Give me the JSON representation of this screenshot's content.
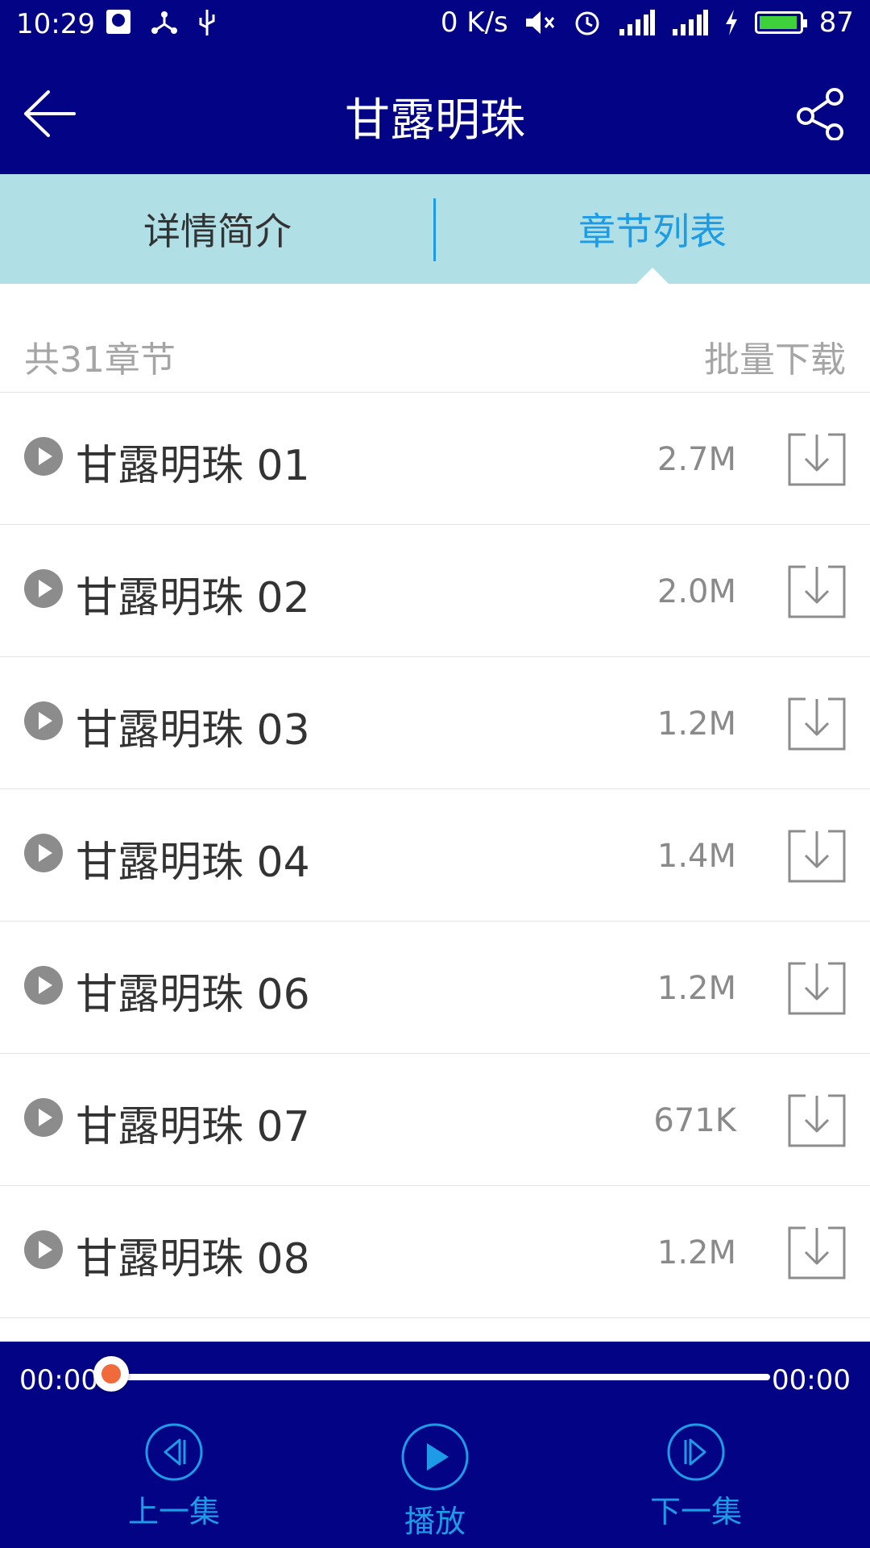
{
  "status_bar": {
    "time": "10:29",
    "net_speed": "0 K/s",
    "battery": "87",
    "battery_level": 0.87,
    "icons_left": [
      "qq-icon",
      "share-network-icon",
      "usb-icon"
    ],
    "icons_right": [
      "mute-icon",
      "alarm-icon",
      "signal-icon",
      "signal-4g-icon",
      "charging-icon",
      "battery-icon"
    ]
  },
  "header": {
    "title": "甘露明珠"
  },
  "tabs": [
    {
      "label": "详情简介",
      "active": false
    },
    {
      "label": "章节列表",
      "active": true
    }
  ],
  "summary": {
    "count": "共31章节",
    "batch_download": "批量下载"
  },
  "chapters": [
    {
      "name": "甘露明珠 01",
      "size": "2.7M"
    },
    {
      "name": "甘露明珠 02",
      "size": "2.0M"
    },
    {
      "name": "甘露明珠 03",
      "size": "1.2M"
    },
    {
      "name": "甘露明珠 04",
      "size": "1.4M"
    },
    {
      "name": "甘露明珠 06",
      "size": "1.2M"
    },
    {
      "name": "甘露明珠 07",
      "size": "671K"
    },
    {
      "name": "甘露明珠 08",
      "size": "1.2M"
    }
  ],
  "player": {
    "current_time": "00:00",
    "total_time": "00:00",
    "progress": 0.0,
    "prev_label": "上一集",
    "play_label": "播放",
    "next_label": "下一集"
  },
  "colors": {
    "primary": "#030386",
    "tab_bg": "#b1dfe6",
    "accent": "#1d9be6",
    "knob": "#f06a3b"
  }
}
